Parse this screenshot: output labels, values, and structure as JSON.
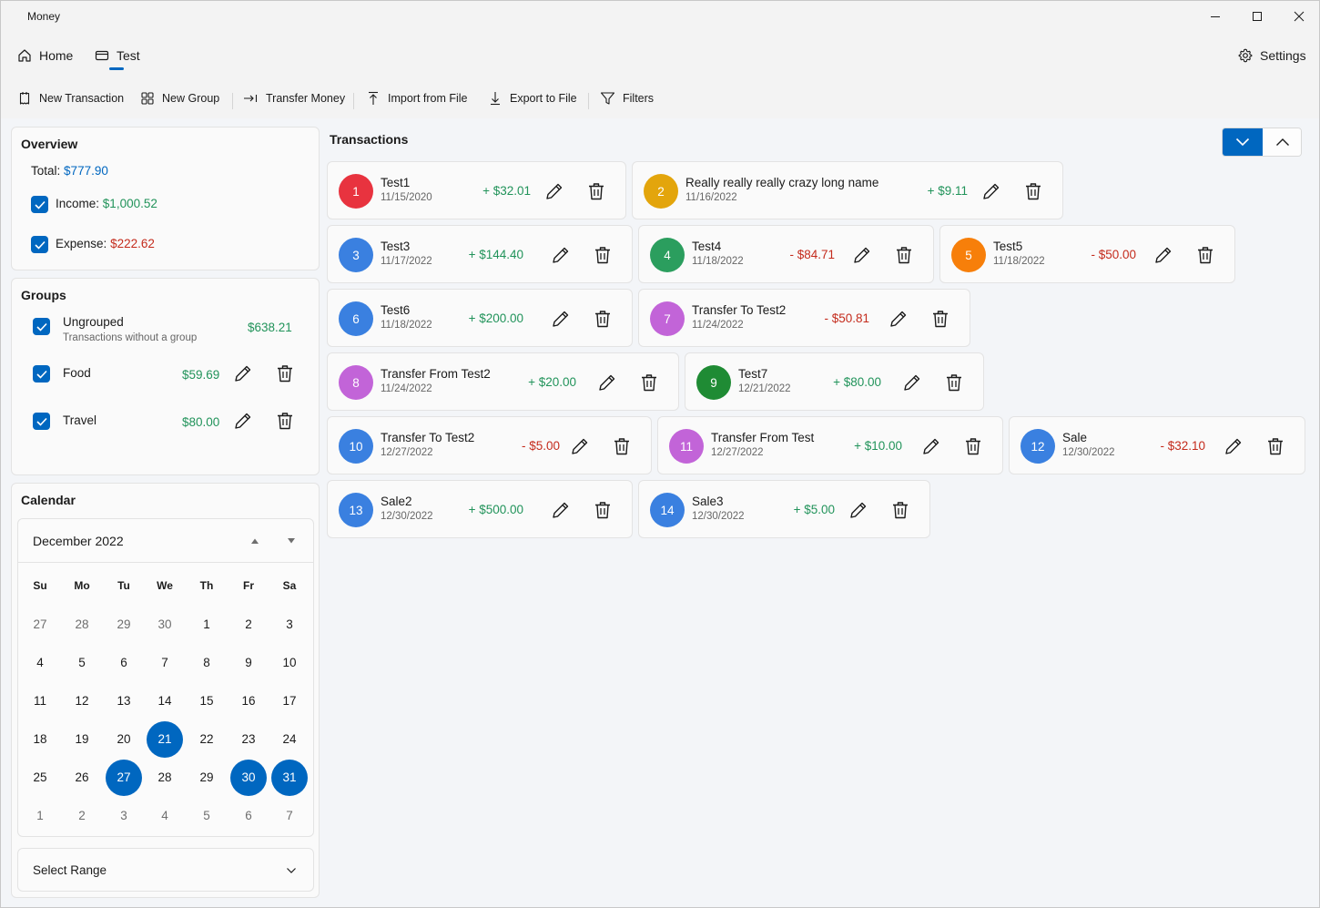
{
  "app": {
    "title": "Money"
  },
  "nav": {
    "home": "Home",
    "test": "Test",
    "settings": "Settings"
  },
  "commands": {
    "new_transaction": "New Transaction",
    "new_group": "New Group",
    "transfer_money": "Transfer Money",
    "import_from_file": "Import from File",
    "export_to_file": "Export to File",
    "filters": "Filters"
  },
  "overview": {
    "title": "Overview",
    "total_label": "Total:",
    "total_value": "$777.90",
    "income_label": "Income:",
    "income_value": "$1,000.52",
    "expense_label": "Expense:",
    "expense_value": "$222.62"
  },
  "groups": {
    "title": "Groups",
    "items": [
      {
        "name": "Ungrouped",
        "description": "Transactions without a group",
        "amount": "$638.21"
      },
      {
        "name": "Food",
        "amount": "$59.69"
      },
      {
        "name": "Travel",
        "amount": "$80.00"
      }
    ]
  },
  "calendar": {
    "title": "Calendar",
    "month": "December 2022",
    "weekdays": [
      "Su",
      "Mo",
      "Tu",
      "We",
      "Th",
      "Fr",
      "Sa"
    ],
    "weeks": [
      [
        "27",
        "28",
        "29",
        "30",
        "1",
        "2",
        "3"
      ],
      [
        "4",
        "5",
        "6",
        "7",
        "8",
        "9",
        "10"
      ],
      [
        "11",
        "12",
        "13",
        "14",
        "15",
        "16",
        "17"
      ],
      [
        "18",
        "19",
        "20",
        "21",
        "22",
        "23",
        "24"
      ],
      [
        "25",
        "26",
        "27",
        "28",
        "29",
        "30",
        "31"
      ],
      [
        "1",
        "2",
        "3",
        "4",
        "5",
        "6",
        "7"
      ]
    ],
    "selected_days": [
      "21",
      "27",
      "30",
      "31"
    ],
    "select_range": "Select Range"
  },
  "transactions": {
    "title": "Transactions",
    "items": [
      {
        "id": "1",
        "name": "Test1",
        "date": "11/15/2020",
        "amount": "+  $32.01",
        "type": "income",
        "color": "#e8333f"
      },
      {
        "id": "2",
        "name": "Really really really crazy long name",
        "date": "11/16/2022",
        "amount": "+  $9.11",
        "type": "income",
        "color": "#e3a50c"
      },
      {
        "id": "3",
        "name": "Test3",
        "date": "11/17/2022",
        "amount": "+  $144.40",
        "type": "income",
        "color": "#3a80e0"
      },
      {
        "id": "4",
        "name": "Test4",
        "date": "11/18/2022",
        "amount": "-  $84.71",
        "type": "expense",
        "color": "#2b9e5e"
      },
      {
        "id": "5",
        "name": "Test5",
        "date": "11/18/2022",
        "amount": "-  $50.00",
        "type": "expense",
        "color": "#f77f0a"
      },
      {
        "id": "6",
        "name": "Test6",
        "date": "11/18/2022",
        "amount": "+  $200.00",
        "type": "income",
        "color": "#3a80e0"
      },
      {
        "id": "7",
        "name": "Transfer To Test2",
        "date": "11/24/2022",
        "amount": "-  $50.81",
        "type": "expense",
        "color": "#c264d8"
      },
      {
        "id": "8",
        "name": "Transfer From Test2",
        "date": "11/24/2022",
        "amount": "+  $20.00",
        "type": "income",
        "color": "#c264d8"
      },
      {
        "id": "9",
        "name": "Test7",
        "date": "12/21/2022",
        "amount": "+  $80.00",
        "type": "income",
        "color": "#1f8b34"
      },
      {
        "id": "10",
        "name": "Transfer To Test2",
        "date": "12/27/2022",
        "amount": "-  $5.00",
        "type": "expense",
        "color": "#3a80e0"
      },
      {
        "id": "11",
        "name": "Transfer From Test",
        "date": "12/27/2022",
        "amount": "+  $10.00",
        "type": "income",
        "color": "#c264d8"
      },
      {
        "id": "12",
        "name": "Sale",
        "date": "12/30/2022",
        "amount": "-  $32.10",
        "type": "expense",
        "color": "#3a80e0"
      },
      {
        "id": "13",
        "name": "Sale2",
        "date": "12/30/2022",
        "amount": "+  $500.00",
        "type": "income",
        "color": "#3a80e0"
      },
      {
        "id": "14",
        "name": "Sale3",
        "date": "12/30/2022",
        "amount": "+  $5.00",
        "type": "income",
        "color": "#3a80e0"
      }
    ]
  }
}
